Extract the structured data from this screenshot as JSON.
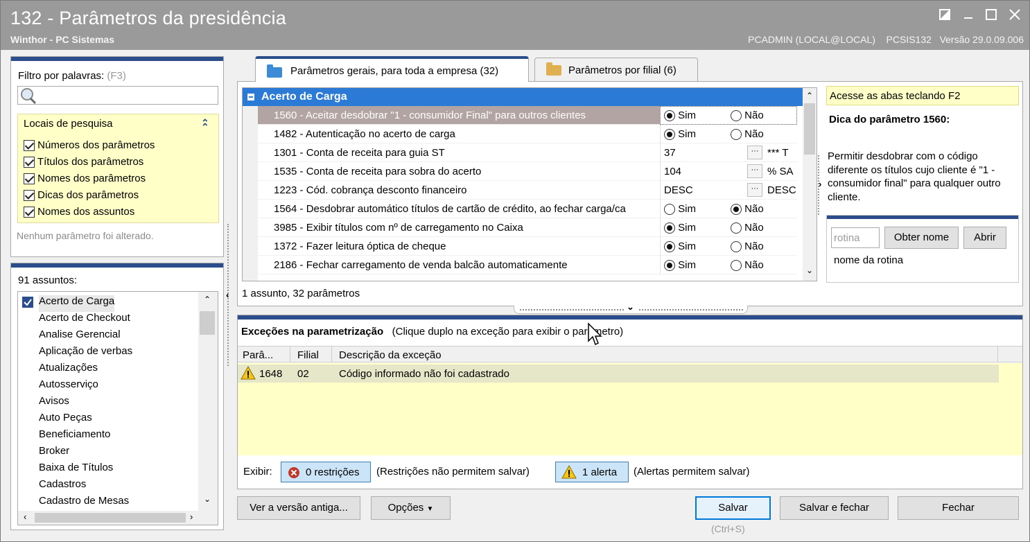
{
  "window": {
    "title": "132 - Parâmetros da presidência",
    "subtitle": "Winthor - PC Sistemas",
    "user": "PCADMIN (LOCAL@LOCAL)",
    "routine": "PCSIS132",
    "version": "Versão  29.0.09.006"
  },
  "filter": {
    "label": "Filtro por palavras:",
    "shortcut": "(F3)",
    "search_value": "",
    "search_locations_title": "Locais de pesquisa",
    "options": [
      {
        "label": "Números dos parâmetros",
        "checked": true
      },
      {
        "label": "Títulos dos parâmetros",
        "checked": true
      },
      {
        "label": "Nomes dos parâmetros",
        "checked": true
      },
      {
        "label": "Dicas dos parâmetros",
        "checked": true
      },
      {
        "label": "Nomes dos assuntos",
        "checked": true
      }
    ],
    "status": "Nenhum parâmetro foi alterado."
  },
  "subjects": {
    "count_label": "91 assuntos:",
    "items": [
      "Acerto de Carga",
      "Acerto de Checkout",
      "Analise Gerencial",
      "Aplicação de verbas",
      "Atualizações",
      "Autosserviço",
      "Avisos",
      "Auto Peças",
      "Beneficiamento",
      "Broker",
      "Baixa de Títulos",
      "Cadastros",
      "Cadastro de Mesas"
    ]
  },
  "tabs": [
    {
      "label": "Parâmetros gerais, para toda a empresa  (32)",
      "active": true
    },
    {
      "label": "Parâmetros por filial  (6)",
      "active": false
    }
  ],
  "grid": {
    "group_title": "Acerto de Carga",
    "sim": "Sim",
    "nao": "Não",
    "rows": [
      {
        "label": "1560 - Aceitar desdobrar \"1 - consumidor Final\" para outros clientes",
        "type": "radio",
        "value": "sim",
        "selected": true
      },
      {
        "label": "1482 - Autenticação no acerto de carga",
        "type": "radio",
        "value": "sim"
      },
      {
        "label": "1301 - Conta de receita para guia ST",
        "type": "lookup",
        "value": "37",
        "extra": "*** T"
      },
      {
        "label": "1535 - Conta de receita para sobra do acerto",
        "type": "lookup",
        "value": "104",
        "extra": "% SA"
      },
      {
        "label": "1223 - Cód. cobrança desconto financeiro",
        "type": "lookup",
        "value": "DESC",
        "extra": "DESC"
      },
      {
        "label": "1564 - Desdobrar automático títulos de cartão de crédito, ao fechar carga/ca",
        "type": "radio",
        "value": "nao"
      },
      {
        "label": "3985 - Exibir títulos com nº de carregamento no Caixa",
        "type": "radio",
        "value": "sim"
      },
      {
        "label": "1372 - Fazer leitura óptica de cheque",
        "type": "radio",
        "value": "sim"
      },
      {
        "label": "2186 - Fechar carregamento de venda balcão automaticamente",
        "type": "radio",
        "value": "sim"
      }
    ],
    "footer": "1 assunto, 32 parâmetros"
  },
  "hint": {
    "tabs_tip": "Acesse as abas teclando F2",
    "title": "Dica do parâmetro 1560:",
    "text": "Permitir desdobrar com o código diferente os títulos cujo cliente é \"1 - consumidor final\" para qualquer outro cliente.",
    "routine_placeholder": "rotina",
    "get_name_button": "Obter nome",
    "open_button": "Abrir",
    "routine_name": "nome da rotina"
  },
  "exceptions": {
    "title": "Exceções na parametrização",
    "subtitle": "(Clique duplo na exceção para exibir o parâmetro)",
    "columns": [
      "Parâ...",
      "Filial",
      "Descrição da exceção"
    ],
    "rows": [
      {
        "param": "1648",
        "filial": "02",
        "desc": "Código informado não foi cadastrado"
      }
    ],
    "show_label": "Exibir:",
    "restrictions_button": "0 restrições",
    "restrictions_note": "(Restrições não permitem salvar)",
    "alerts_button": "1 alerta",
    "alerts_note": "(Alertas permitem salvar)"
  },
  "footer": {
    "old_version": "Ver a versão antiga...",
    "options": "Opções",
    "save": "Salvar",
    "save_shortcut": "(Ctrl+S)",
    "save_close": "Salvar e fechar",
    "close": "Fechar"
  },
  "colors": {
    "accent_blue": "#2b4d8c",
    "hint_yellow": "#ffffc8",
    "selected_row": "#b3a4a4"
  }
}
